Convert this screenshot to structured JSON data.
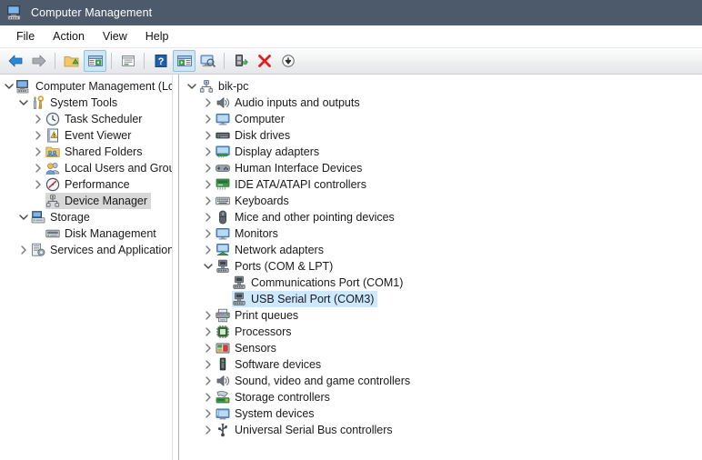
{
  "window": {
    "title": "Computer Management",
    "icon": "computer-management-icon"
  },
  "menu": {
    "items": [
      {
        "label": "File",
        "name": "menu-file"
      },
      {
        "label": "Action",
        "name": "menu-action"
      },
      {
        "label": "View",
        "name": "menu-view"
      },
      {
        "label": "Help",
        "name": "menu-help"
      }
    ]
  },
  "toolbar": {
    "buttons": [
      {
        "name": "back-button",
        "icon": "back-arrow-icon",
        "state": "enabled"
      },
      {
        "name": "forward-button",
        "icon": "forward-arrow-icon",
        "state": "disabled"
      },
      {
        "name": "separator-1",
        "icon": "separator",
        "state": "static"
      },
      {
        "name": "up-one-level-button",
        "icon": "folder-up-icon",
        "state": "enabled"
      },
      {
        "name": "show-hide-console-tree-button",
        "icon": "console-tree-icon",
        "state": "active"
      },
      {
        "name": "separator-2",
        "icon": "separator",
        "state": "static"
      },
      {
        "name": "properties-button",
        "icon": "properties-icon",
        "state": "enabled"
      },
      {
        "name": "separator-3",
        "icon": "separator",
        "state": "static"
      },
      {
        "name": "help-button",
        "icon": "help-question-icon",
        "state": "enabled"
      },
      {
        "name": "show-action-pane-button",
        "icon": "action-pane-icon",
        "state": "active"
      },
      {
        "name": "display-monitor-button",
        "icon": "monitor-search-icon",
        "state": "enabled"
      },
      {
        "name": "separator-4",
        "icon": "separator",
        "state": "static"
      },
      {
        "name": "scan-hardware-changes-button",
        "icon": "scan-hardware-icon",
        "state": "enabled"
      },
      {
        "name": "uninstall-device-button",
        "icon": "red-x-icon",
        "state": "enabled"
      },
      {
        "name": "disable-device-button",
        "icon": "down-arrow-circle-icon",
        "state": "enabled"
      }
    ]
  },
  "console_tree": {
    "items": [
      {
        "label": "Computer Management (Local",
        "icon": "computer-management-icon",
        "indent": 0,
        "chevron": "down",
        "selected": false
      },
      {
        "label": "System Tools",
        "icon": "system-tools-icon",
        "indent": 1,
        "chevron": "down",
        "selected": false
      },
      {
        "label": "Task Scheduler",
        "icon": "task-scheduler-icon",
        "indent": 2,
        "chevron": "right",
        "selected": false
      },
      {
        "label": "Event Viewer",
        "icon": "event-viewer-icon",
        "indent": 2,
        "chevron": "right",
        "selected": false
      },
      {
        "label": "Shared Folders",
        "icon": "shared-folders-icon",
        "indent": 2,
        "chevron": "right",
        "selected": false
      },
      {
        "label": "Local Users and Groups",
        "icon": "local-users-groups-icon",
        "indent": 2,
        "chevron": "right",
        "selected": false
      },
      {
        "label": "Performance",
        "icon": "performance-icon",
        "indent": 2,
        "chevron": "right",
        "selected": false
      },
      {
        "label": "Device Manager",
        "icon": "device-manager-icon",
        "indent": 2,
        "chevron": "none",
        "selected": true
      },
      {
        "label": "Storage",
        "icon": "storage-icon",
        "indent": 1,
        "chevron": "down",
        "selected": false
      },
      {
        "label": "Disk Management",
        "icon": "disk-management-icon",
        "indent": 2,
        "chevron": "none",
        "selected": false
      },
      {
        "label": "Services and Applications",
        "icon": "services-apps-icon",
        "indent": 1,
        "chevron": "right",
        "selected": false
      }
    ]
  },
  "device_tree": {
    "items": [
      {
        "label": "bik-pc",
        "icon": "computer-node-icon",
        "indent": 0,
        "chevron": "down",
        "selected": false
      },
      {
        "label": "Audio inputs and outputs",
        "icon": "speaker-icon",
        "indent": 1,
        "chevron": "right",
        "selected": false
      },
      {
        "label": "Computer",
        "icon": "monitor-icon",
        "indent": 1,
        "chevron": "right",
        "selected": false
      },
      {
        "label": "Disk drives",
        "icon": "disk-drive-icon",
        "indent": 1,
        "chevron": "right",
        "selected": false
      },
      {
        "label": "Display adapters",
        "icon": "display-adapter-icon",
        "indent": 1,
        "chevron": "right",
        "selected": false
      },
      {
        "label": "Human Interface Devices",
        "icon": "hid-icon",
        "indent": 1,
        "chevron": "right",
        "selected": false
      },
      {
        "label": "IDE ATA/ATAPI controllers",
        "icon": "ide-controller-icon",
        "indent": 1,
        "chevron": "right",
        "selected": false
      },
      {
        "label": "Keyboards",
        "icon": "keyboard-icon",
        "indent": 1,
        "chevron": "right",
        "selected": false
      },
      {
        "label": "Mice and other pointing devices",
        "icon": "mouse-icon",
        "indent": 1,
        "chevron": "right",
        "selected": false
      },
      {
        "label": "Monitors",
        "icon": "monitor-icon",
        "indent": 1,
        "chevron": "right",
        "selected": false
      },
      {
        "label": "Network adapters",
        "icon": "network-adapter-icon",
        "indent": 1,
        "chevron": "right",
        "selected": false
      },
      {
        "label": "Ports (COM & LPT)",
        "icon": "port-icon",
        "indent": 1,
        "chevron": "down",
        "selected": false
      },
      {
        "label": "Communications Port (COM1)",
        "icon": "port-icon",
        "indent": 2,
        "chevron": "none",
        "selected": false
      },
      {
        "label": "USB Serial Port (COM3)",
        "icon": "port-icon",
        "indent": 2,
        "chevron": "none",
        "selected": true
      },
      {
        "label": "Print queues",
        "icon": "printer-icon",
        "indent": 1,
        "chevron": "right",
        "selected": false
      },
      {
        "label": "Processors",
        "icon": "processor-icon",
        "indent": 1,
        "chevron": "right",
        "selected": false
      },
      {
        "label": "Sensors",
        "icon": "sensor-icon",
        "indent": 1,
        "chevron": "right",
        "selected": false
      },
      {
        "label": "Software devices",
        "icon": "software-device-icon",
        "indent": 1,
        "chevron": "right",
        "selected": false
      },
      {
        "label": "Sound, video and game controllers",
        "icon": "speaker-icon",
        "indent": 1,
        "chevron": "right",
        "selected": false
      },
      {
        "label": "Storage controllers",
        "icon": "storage-controller-icon",
        "indent": 1,
        "chevron": "right",
        "selected": false
      },
      {
        "label": "System devices",
        "icon": "system-device-icon",
        "indent": 1,
        "chevron": "right",
        "selected": false
      },
      {
        "label": "Universal Serial Bus controllers",
        "icon": "usb-controller-icon",
        "indent": 1,
        "chevron": "right",
        "selected": false
      }
    ]
  },
  "colors": {
    "titlebar": "#4d5a6b",
    "selection_focused": "#cde8ff",
    "selection_unfocused": "#d8d8d8",
    "toolbar_active": "#cfe6f7",
    "accent_red": "#e02020"
  }
}
